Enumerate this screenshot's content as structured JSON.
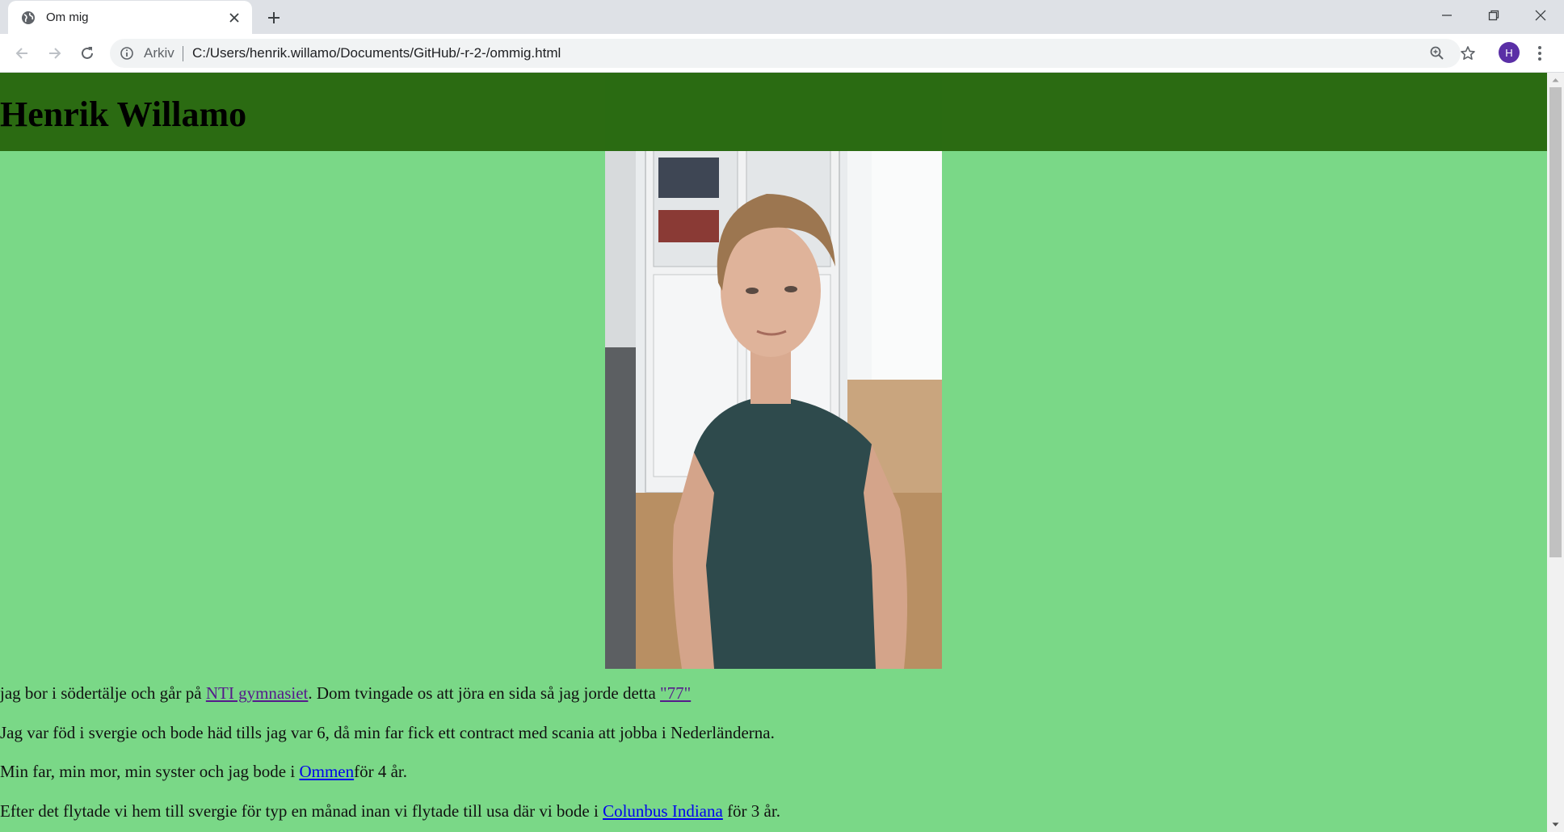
{
  "browser": {
    "tab": {
      "title": "Om mig",
      "icon": "globe-icon"
    },
    "address": {
      "scheme_label": "Arkiv",
      "url": "C:/Users/henrik.willamo/Documents/GitHub/-r-2-/ommig.html"
    },
    "profile_initial": "H"
  },
  "page": {
    "title": "Henrik Willamo",
    "header_color": "#2b6b12",
    "background_color": "#7ad887",
    "photo": {
      "description_icon": "portrait-photo"
    },
    "paragraphs": [
      {
        "before": "jag bor i södertälje och går på ",
        "link1": "NTI gymnasiet",
        "middle": ". Dom tvingade os att jöra en sida så jag jorde detta ",
        "link2": "\"77\""
      },
      {
        "text": "Jag var föd i svergie och bode häd tills jag var 6, då min far fick ett contract med scania att jobba i Nederländerna."
      },
      {
        "before": "Min far, min mor, min syster och jag bode i ",
        "link": "Ommen",
        "after": "för 4 år."
      },
      {
        "before": "Efter det flytade vi hem till svergie för typ en månad inan vi flytade till usa där vi bode i ",
        "link": "Colunbus Indiana",
        "after": " för 3 år."
      }
    ]
  }
}
